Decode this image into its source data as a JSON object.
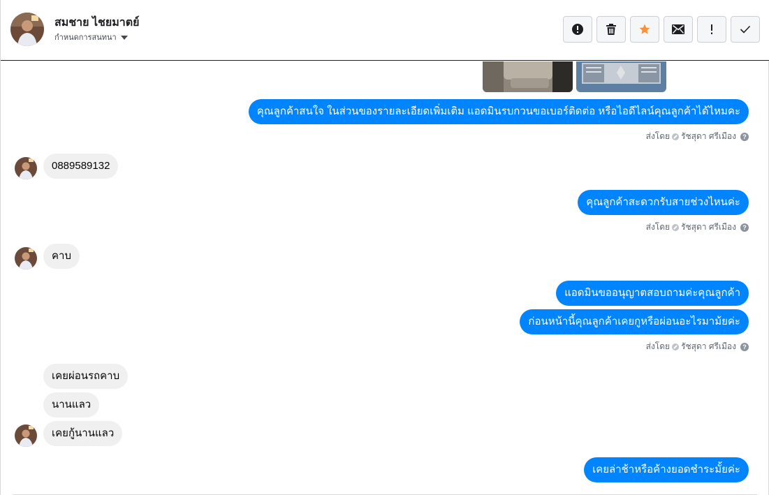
{
  "header": {
    "contact_name": "สมชาย ไชยมาตย์",
    "subtitle": "กำหนดการสนทนา",
    "actions": [
      {
        "name": "spam-button",
        "icon": "alert-circle-icon"
      },
      {
        "name": "delete-button",
        "icon": "trash-icon"
      },
      {
        "name": "star-button",
        "icon": "star-icon",
        "color": "#f7923b"
      },
      {
        "name": "mark-unread-button",
        "icon": "envelope-icon"
      },
      {
        "name": "important-button",
        "icon": "exclamation-icon"
      },
      {
        "name": "done-button",
        "icon": "check-icon"
      }
    ]
  },
  "colors": {
    "outgoing_bubble": "#0084ff",
    "incoming_bubble": "#f0f0f0",
    "star": "#f7923b"
  },
  "messages": {
    "out_1": "คุณลูกค้าสนใจ ในส่วนของรายละเอียดเพิ่มเติม แอดมินรบกวนขอเบอร์ติดต่อ หรือไอดีไลน์คุณลูกค้าได้ไหมคะ",
    "in_1": "0889589132",
    "out_2": "คุณลูกค้าสะดวกรับสายช่วงไหนค่ะ",
    "in_2": "คาบ",
    "out_3a": "แอดมินขออนุญาตสอบถามค่ะคุณลูกค้า",
    "out_3b": "ก่อนหน้านี้คุณลูกค้าเคยกูหรือผ่อนอะไรมาม้ยค่ะ",
    "in_3a": "เคยผ่อนรถคาบ",
    "in_3b": "นานแลว",
    "in_3c": "เคยกู้นานแลว",
    "out_4": "เคยล่าช้าหรือค้างยอดชำระมั้ยค่ะ"
  },
  "sent_by": {
    "prefix": "ส่งโดย",
    "agent": "รัชสุดา ศรีเมือง",
    "help": "?"
  }
}
